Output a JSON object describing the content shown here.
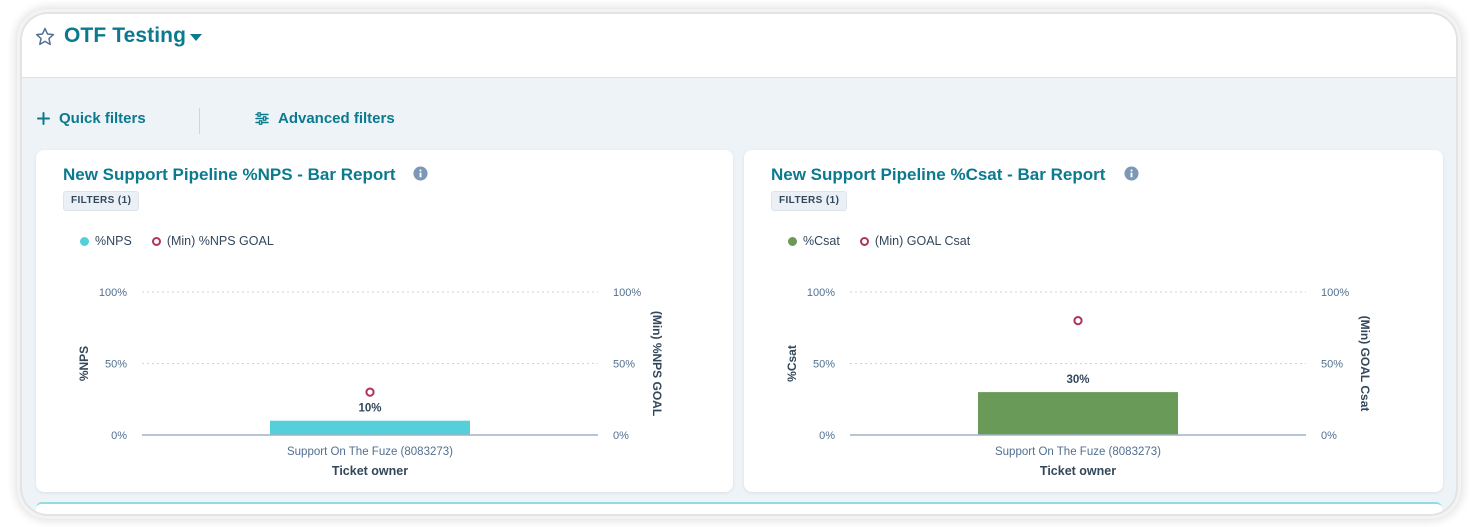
{
  "dashboard": {
    "title": "OTF Testing",
    "star_icon": "star-outline-icon",
    "caret_icon": "caret-down-icon"
  },
  "filters": {
    "quick_label": "Quick filters",
    "advanced_label": "Advanced filters"
  },
  "reports": [
    {
      "title": "New Support Pipeline %NPS - Bar Report",
      "badge": "FILTERS (1)",
      "legend": [
        "%NPS",
        "(Min) %NPS GOAL"
      ],
      "ylabel": "%NPS",
      "y2label": "(Min) %NPS GOAL",
      "xlabel": "Ticket owner",
      "category": "Support On The Fuze (8083273)",
      "ticks": [
        "100%",
        "50%",
        "0%"
      ],
      "bar_label": "10%",
      "colors": {
        "bar": "#55cfd9",
        "goal": "#b0345a"
      }
    },
    {
      "title": "New Support Pipeline %Csat - Bar Report",
      "badge": "FILTERS (1)",
      "legend": [
        "%Csat",
        "(Min) GOAL Csat"
      ],
      "ylabel": "%Csat",
      "y2label": "(Min) GOAL Csat",
      "xlabel": "Ticket owner",
      "category": "Support On The Fuze (8083273)",
      "ticks": [
        "100%",
        "50%",
        "0%"
      ],
      "bar_label": "30%",
      "colors": {
        "bar": "#6a9a58",
        "goal": "#b0345a"
      }
    }
  ],
  "chart_data": [
    {
      "type": "bar",
      "title": "New Support Pipeline %NPS - Bar Report",
      "categories": [
        "Support On The Fuze (8083273)"
      ],
      "series": [
        {
          "name": "%NPS",
          "values": [
            10
          ]
        },
        {
          "name": "(Min) %NPS GOAL",
          "values": [
            30
          ]
        }
      ],
      "xlabel": "Ticket owner",
      "ylabel": "%NPS",
      "y2label": "(Min) %NPS GOAL",
      "ylim": [
        0,
        100
      ],
      "grid": true,
      "legend": "top-left"
    },
    {
      "type": "bar",
      "title": "New Support Pipeline %Csat - Bar Report",
      "categories": [
        "Support On The Fuze (8083273)"
      ],
      "series": [
        {
          "name": "%Csat",
          "values": [
            30
          ]
        },
        {
          "name": "(Min) GOAL Csat",
          "values": [
            80
          ]
        }
      ],
      "xlabel": "Ticket owner",
      "ylabel": "%Csat",
      "y2label": "(Min) GOAL Csat",
      "ylim": [
        0,
        100
      ],
      "grid": true,
      "legend": "top-left"
    }
  ]
}
